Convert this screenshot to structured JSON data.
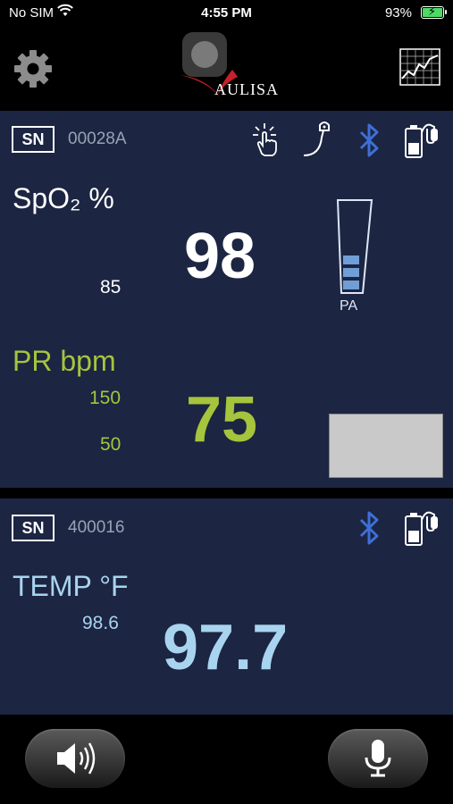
{
  "status_bar": {
    "carrier": "No SIM",
    "time": "4:55 PM",
    "battery_percent": "93%",
    "battery_color": "#4cd964"
  },
  "header": {
    "logo_text": "AULISA",
    "icons": [
      "gear-icon",
      "trend-chart-icon"
    ]
  },
  "oximeter": {
    "sn_badge": "SN",
    "serial": "00028A",
    "status_icons": [
      "finger-touch-icon",
      "sensor-probe-icon",
      "bluetooth-icon",
      "battery-icon"
    ],
    "spo2_label": "SpO₂ %",
    "spo2_low_alarm": "85",
    "spo2_value": "98",
    "pa_label": "PA",
    "pa_level_bars": 3,
    "pr_label": "PR bpm",
    "pr_high_alarm": "150",
    "pr_low_alarm": "50",
    "pr_value": "75",
    "spo2_color": "#ffffff",
    "pr_color": "#a6c43c"
  },
  "thermometer": {
    "sn_badge": "SN",
    "serial": "400016",
    "status_icons": [
      "bluetooth-icon",
      "battery-icon"
    ],
    "temp_label": "TEMP °F",
    "temp_alarm": "98.6",
    "temp_value": "97.7",
    "temp_color": "#a9d4ef"
  },
  "bottom_bar": {
    "buttons": [
      "speaker-button",
      "microphone-button"
    ]
  },
  "theme": {
    "panel_bg": "#1c2542",
    "bluetooth_color": "#3d6fd6"
  }
}
